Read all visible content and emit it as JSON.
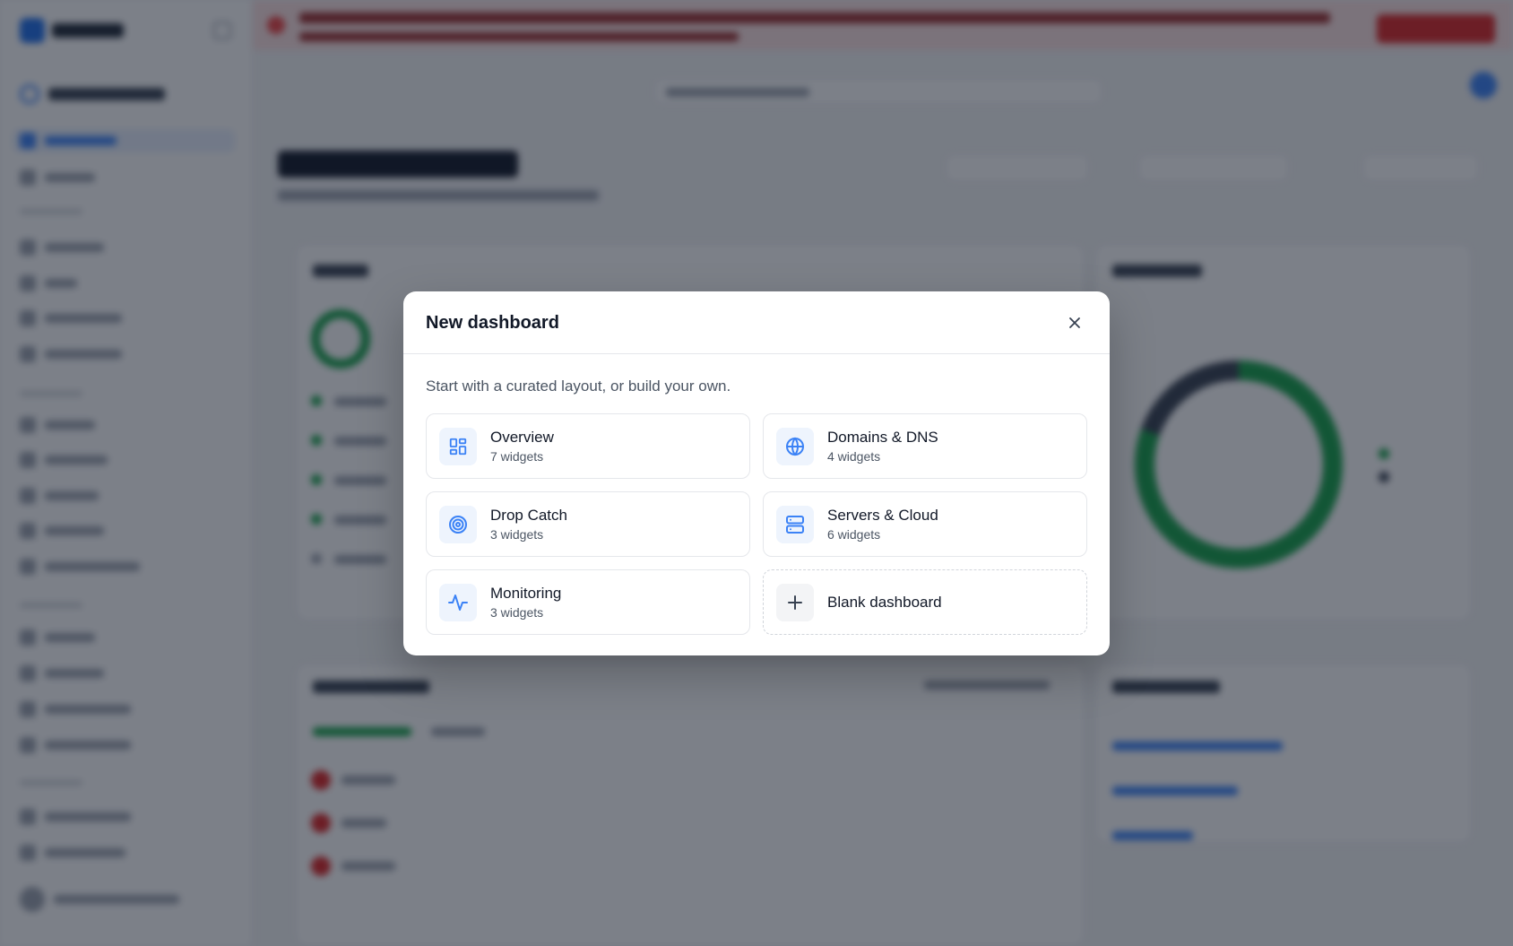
{
  "modal": {
    "title": "New dashboard",
    "description": "Start with a curated layout, or build your own.",
    "close_icon": "close-icon",
    "options": [
      {
        "name": "Overview",
        "count": "7 widgets",
        "icon": "layout-grid-icon"
      },
      {
        "name": "Domains & DNS",
        "count": "4 widgets",
        "icon": "globe-icon"
      },
      {
        "name": "Drop Catch",
        "count": "3 widgets",
        "icon": "target-icon"
      },
      {
        "name": "Servers & Cloud",
        "count": "6 widgets",
        "icon": "server-icon"
      },
      {
        "name": "Monitoring",
        "count": "3 widgets",
        "icon": "activity-icon"
      },
      {
        "name": "Blank dashboard",
        "icon": "plus-icon"
      }
    ]
  },
  "colors": {
    "accent": "#3b82f6",
    "overlay": "rgba(17, 24, 39, 0.55)",
    "danger_banner": "#fde2e2",
    "success": "#16a34a"
  }
}
